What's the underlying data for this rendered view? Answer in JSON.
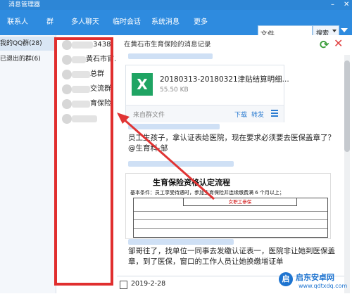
{
  "window": {
    "title": "消息管理器"
  },
  "menu": {
    "contacts": "联系人",
    "groups": "群",
    "multi_chat": "多人聊天",
    "temp_chat": "临时会话",
    "system_msg": "系统消息",
    "more": "更多"
  },
  "search": {
    "value": "文件",
    "button": "搜索"
  },
  "left_list": [
    {
      "label": "我的QQ群(28)"
    },
    {
      "label": "已退出的群(6)"
    }
  ],
  "group_list": [
    {
      "label": "3438"
    },
    {
      "label": "黄石市官..."
    },
    {
      "label": "总群"
    },
    {
      "label": "交流群"
    },
    {
      "label": "育保险"
    },
    {
      "label": ""
    }
  ],
  "content": {
    "title": "在黄石市生育保险的消息记录",
    "file": {
      "name": "20180313-20180321津贴结算明细...",
      "size": "55.50 KB",
      "source": "来自群文件",
      "download": "下载",
      "forward": "转发"
    },
    "message": "员工生孩子，拿认证表给医院，现在要求必须要去医保盖章了？@生育科-邹",
    "document": {
      "title": "生育保险资格认定流程",
      "subtitle": "基本条件：员工享受待遇时，参加生育保险并连续缴费满 6 个月以上；",
      "header": "女职工参保"
    },
    "message2": "邹哥往了，找单位一同事去发缴认证表一，医院非让她到医保盖章，到了医保，窗口的工作人员让她换缴增证单",
    "date": "2019-2-28"
  },
  "watermark": {
    "name": "启东安卓网",
    "url": "www.qdtxdq.com"
  }
}
